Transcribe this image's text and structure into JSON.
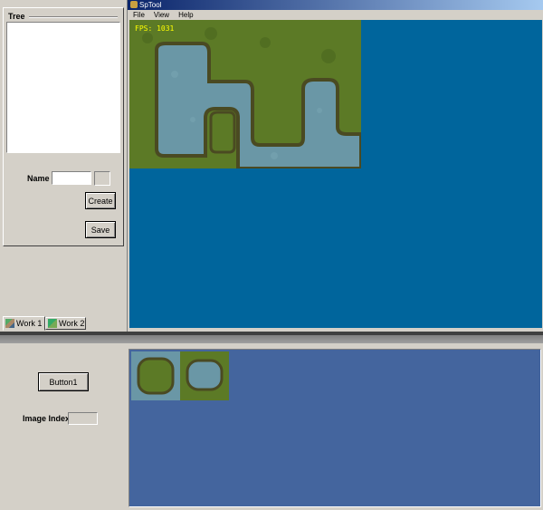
{
  "left_panel": {
    "tree_label": "Tree",
    "name_label": "Name",
    "name_value": "",
    "create_button": "Create",
    "save_button": "Save",
    "tabs": [
      "Work 1",
      "Work 2"
    ]
  },
  "window": {
    "title": "SpTool",
    "menu": [
      "File",
      "View",
      "Help"
    ],
    "fps_text": "FPS:  1031"
  },
  "bottom_panel": {
    "button1_label": "Button1",
    "image_index_label": "Image Index",
    "image_index_value": ""
  },
  "colors": {
    "canvas_blue": "#00659c",
    "tile_panel_blue": "#44659e",
    "grass": "#5c7a26",
    "water": "#6a97a6",
    "fps_yellow": "#ffff00",
    "title_bar": "#0a246a"
  }
}
